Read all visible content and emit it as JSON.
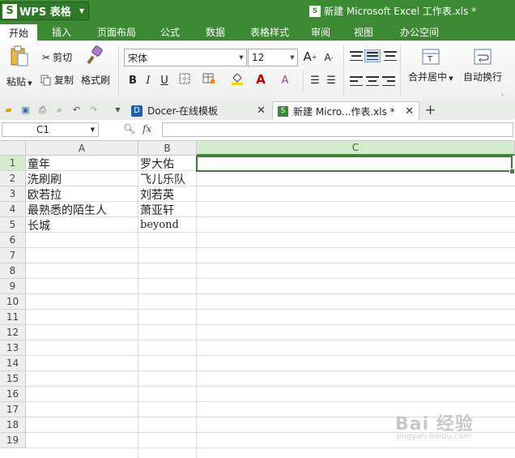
{
  "app": {
    "name": "WPS 表格",
    "logo_letter": "S"
  },
  "document": {
    "title": "新建 Microsoft Excel 工作表.xls *"
  },
  "menu": [
    "开始",
    "插入",
    "页面布局",
    "公式",
    "数据",
    "表格样式",
    "审阅",
    "视图",
    "办公空间"
  ],
  "ribbon": {
    "paste": "粘贴",
    "cut": "剪切",
    "copy": "复制",
    "format_painter": "格式刷",
    "font_name": "宋体",
    "font_size": "12",
    "bold": "B",
    "italic": "I",
    "underline": "U",
    "font_color_letter": "A",
    "grow_font": "A",
    "shrink_font": "A",
    "merge_center": "合并居中",
    "wrap_text": "自动换行"
  },
  "tabs": [
    {
      "label": "Docer-在线模板",
      "icon": "docer-icon"
    },
    {
      "label": "新建 Micro...作表.xls *",
      "icon": "sheet-icon"
    }
  ],
  "formula_bar": {
    "cell_ref": "C1",
    "fx": "fx",
    "value": ""
  },
  "columns": [
    "A",
    "B",
    "C"
  ],
  "rows": [
    "1",
    "2",
    "3",
    "4",
    "5",
    "6",
    "7",
    "8",
    "9",
    "10",
    "11",
    "12",
    "13",
    "14",
    "15",
    "16",
    "17",
    "18",
    "19"
  ],
  "cells": [
    {
      "a": "童年",
      "b": "罗大佑"
    },
    {
      "a": "洗刷刷",
      "b": "飞儿乐队"
    },
    {
      "a": "欧若拉",
      "b": "刘若英"
    },
    {
      "a": "最熟悉的陌生人",
      "b": "萧亚轩"
    },
    {
      "a": "长城",
      "b": "beyond"
    }
  ],
  "selection": {
    "cell": "C1",
    "column": "C",
    "row": "1"
  },
  "watermark": {
    "text": "Bai 经验",
    "sub": "jingyan.baidu.com"
  },
  "colors": {
    "accent": "#3d8a35",
    "selection": "#3a7f33"
  }
}
